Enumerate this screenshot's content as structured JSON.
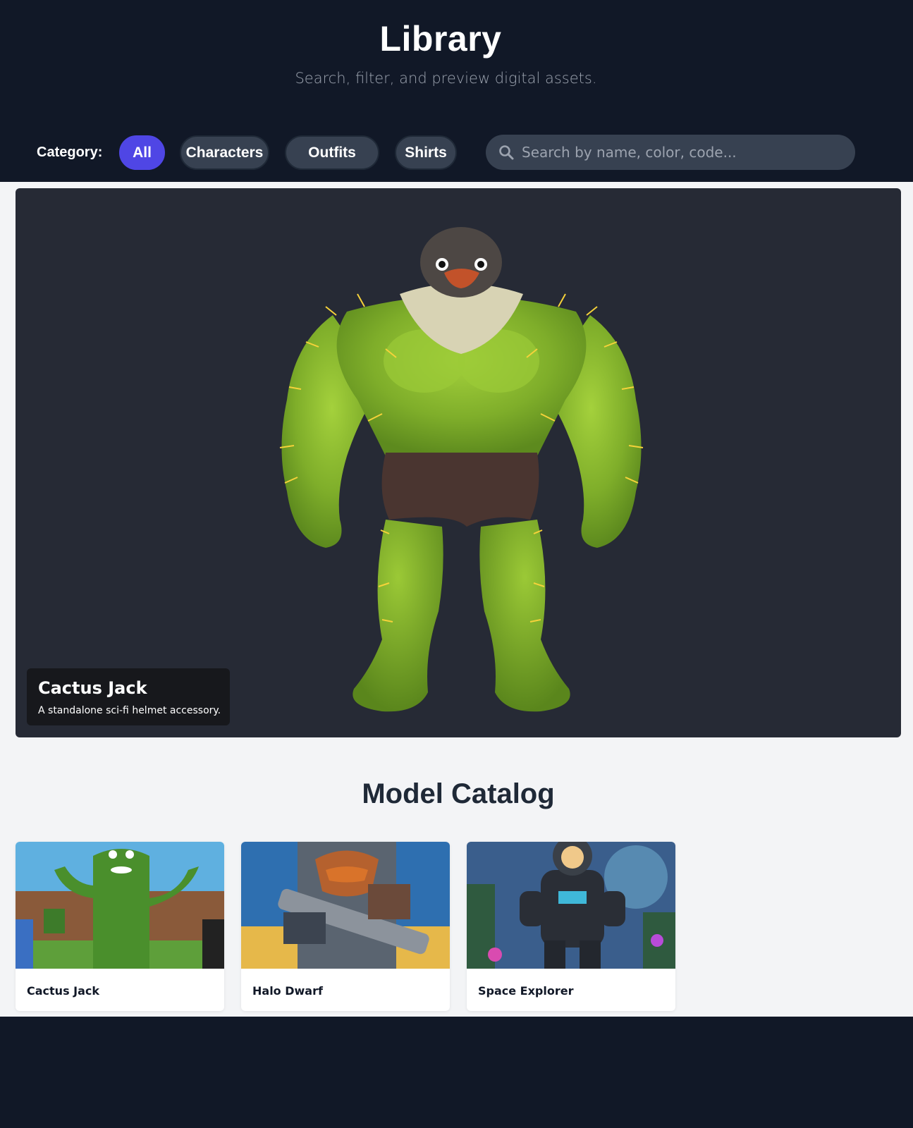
{
  "header": {
    "title": "Library",
    "subtitle": "Search, filter, and preview digital assets."
  },
  "filters": {
    "label": "Category:",
    "categories": [
      {
        "label": "All",
        "active": true
      },
      {
        "label": "Characters",
        "active": false
      },
      {
        "label": "Outfits",
        "active": false
      },
      {
        "label": "Shirts",
        "active": false
      }
    ]
  },
  "search": {
    "placeholder": "Search by name, color, code...",
    "value": "",
    "icon": "search-icon"
  },
  "viewer": {
    "title": "Cactus Jack",
    "description": "A standalone sci-fi helmet accessory."
  },
  "catalog": {
    "title": "Model Catalog",
    "items": [
      {
        "name": "Cactus Jack"
      },
      {
        "name": "Halo Dwarf"
      },
      {
        "name": "Space Explorer"
      }
    ]
  },
  "colors": {
    "background": "#111827",
    "accent": "#4f46e5",
    "pill": "#374151",
    "content_bg": "#f3f4f6",
    "viewer_bg": "#262a35"
  }
}
